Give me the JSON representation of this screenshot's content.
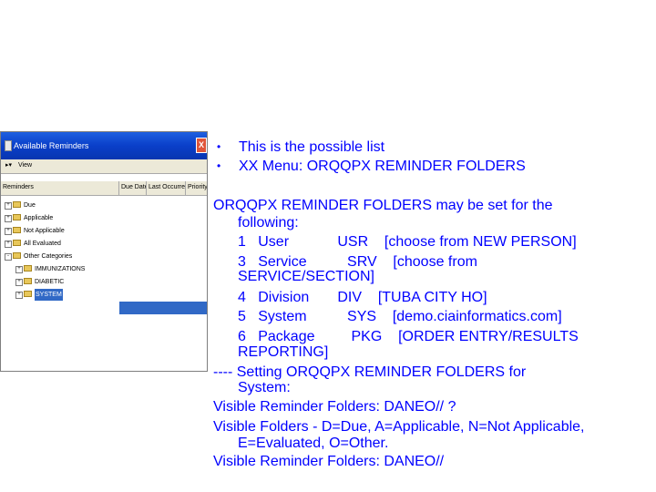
{
  "window": {
    "title": "Available Reminders",
    "close": "X",
    "view_label": "View",
    "columns": [
      "Reminders",
      "Due Date",
      "Last Occurrence",
      "Priority"
    ],
    "tree": [
      {
        "label": "Due",
        "level": 0,
        "expander": "+"
      },
      {
        "label": "Applicable",
        "level": 0,
        "expander": "+"
      },
      {
        "label": "Not Applicable",
        "level": 0,
        "expander": "+"
      },
      {
        "label": "All Evaluated",
        "level": 0,
        "expander": "+"
      },
      {
        "label": "Other Categories",
        "level": 0,
        "expander": "-"
      },
      {
        "label": "IMMUNIZATIONS",
        "level": 1,
        "expander": "+"
      },
      {
        "label": "DIABETIC",
        "level": 1,
        "expander": "+"
      },
      {
        "label": "SYSTEM",
        "level": 1,
        "expander": "+",
        "selected": true
      }
    ]
  },
  "bullets": [
    "This is the possible list",
    "XX Menu: ORQQPX REMINDER FOLDERS"
  ],
  "body_lines": [
    "ORQQPX REMINDER FOLDERS may be set for the",
    "following:",
    "1   User            USR    [choose from NEW PERSON]",
    "3   Service          SRV    [choose from",
    "SERVICE/SECTION]",
    "4   Division       DIV    [TUBA CITY HO]",
    "5   System          SYS    [demo.ciainformatics.com]",
    "6   Package         PKG    [ORDER ENTRY/RESULTS",
    "REPORTING]",
    "---- Setting ORQQPX REMINDER FOLDERS  for",
    "System:",
    "Visible Reminder Folders: DANEO// ?",
    "Visible Folders - D=Due, A=Applicable, N=Not Applicable,",
    "E=Evaluated, O=Other.",
    "Visible Reminder Folders: DANEO//"
  ],
  "colors": {
    "text": "#0000ff",
    "titlebar": "#0a3fc9",
    "selection": "#3169c6"
  }
}
